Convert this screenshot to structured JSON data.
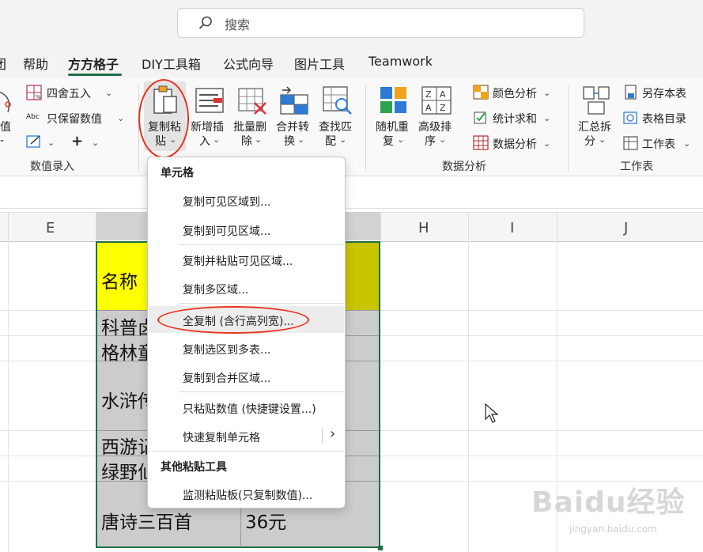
{
  "search": {
    "placeholder": "搜索"
  },
  "tabs": [
    {
      "label": "团"
    },
    {
      "label": "帮助"
    },
    {
      "label": "方方格子"
    },
    {
      "label": "DIY工具箱"
    },
    {
      "label": "公式向导"
    },
    {
      "label": "图片工具"
    },
    {
      "label": "Teamwork"
    }
  ],
  "ribbon": {
    "left_partial": {
      "line1": "值",
      "line2": "-"
    },
    "numeric_entry": {
      "round_label": "四舍五入",
      "keep_values_label": "只保留数值",
      "abc_label": "Abc",
      "plus": "+",
      "group_label": "数值录入"
    },
    "copy_paste": {
      "line1": "复制粘",
      "line2": "贴"
    },
    "insert": {
      "line1": "新增插",
      "line2": "入"
    },
    "batch_delete": {
      "line1": "批量删",
      "line2": "除"
    },
    "merge_convert": {
      "line1": "合并转",
      "line2": "换"
    },
    "find_match": {
      "line1": "查找匹",
      "line2": "配"
    },
    "random_reorder": {
      "line1": "随机重",
      "line2": "复"
    },
    "advanced_sort": {
      "line1": "高级排",
      "line2": "序"
    },
    "data_analysis": {
      "color_analysis": "颜色分析",
      "stat_sum": "统计求和",
      "data_analysis": "数据分析",
      "group_label": "数据分析"
    },
    "summary_split": {
      "line1": "汇总拆",
      "line2": "分"
    },
    "worksheet": {
      "save_as": "另存本表",
      "table_dir": "表格目录",
      "worksheet": "工作表",
      "group_label": "工作表"
    }
  },
  "columns": [
    "E",
    "H",
    "I",
    "J"
  ],
  "cells": {
    "name_header": "名称",
    "row1": "科普卤",
    "row2": "格林童",
    "row3": "水浒传",
    "row4": "西游记",
    "row5": "绿野仙",
    "row6": "唐诗三百首",
    "row6_price": "36元"
  },
  "menu": {
    "section1": "单元格",
    "items1": [
      "复制可见区域到...",
      "复制到可见区域...",
      "复制并粘贴可见区域...",
      "复制多区域...",
      "全复制 (含行高列宽)...",
      "复制选区到多表...",
      "复制到合并区域...",
      "只粘贴数值 (快捷键设置...)",
      "快速复制单元格"
    ],
    "submenu_arrow": "›",
    "section2": "其他粘贴工具",
    "items2": [
      "监测粘贴板(只复制数值)..."
    ]
  },
  "watermark": {
    "logo": "Baidu经验",
    "url": "jingyan.baidu.com"
  },
  "colors": {
    "accent": "#1e7145",
    "highlight_red": "#e8321c",
    "header_yellow": "#ffff00",
    "olive": "#c8c400"
  }
}
